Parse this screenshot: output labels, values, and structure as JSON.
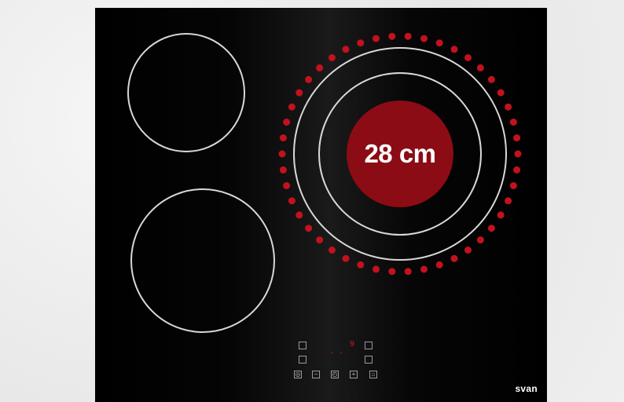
{
  "zone_label": "28 cm",
  "display": {
    "left": "- -",
    "right": "9"
  },
  "brand": "svan",
  "controls": [
    {
      "icon": "power-icon"
    },
    {
      "icon": "minus-icon"
    },
    {
      "icon": "timer-icon"
    },
    {
      "icon": "plus-icon"
    },
    {
      "icon": "lock-icon"
    }
  ],
  "colors": {
    "accent": "#8b0c14",
    "dots": "#c2121d",
    "glass": "#000000",
    "ring": "#d8d8d8"
  }
}
